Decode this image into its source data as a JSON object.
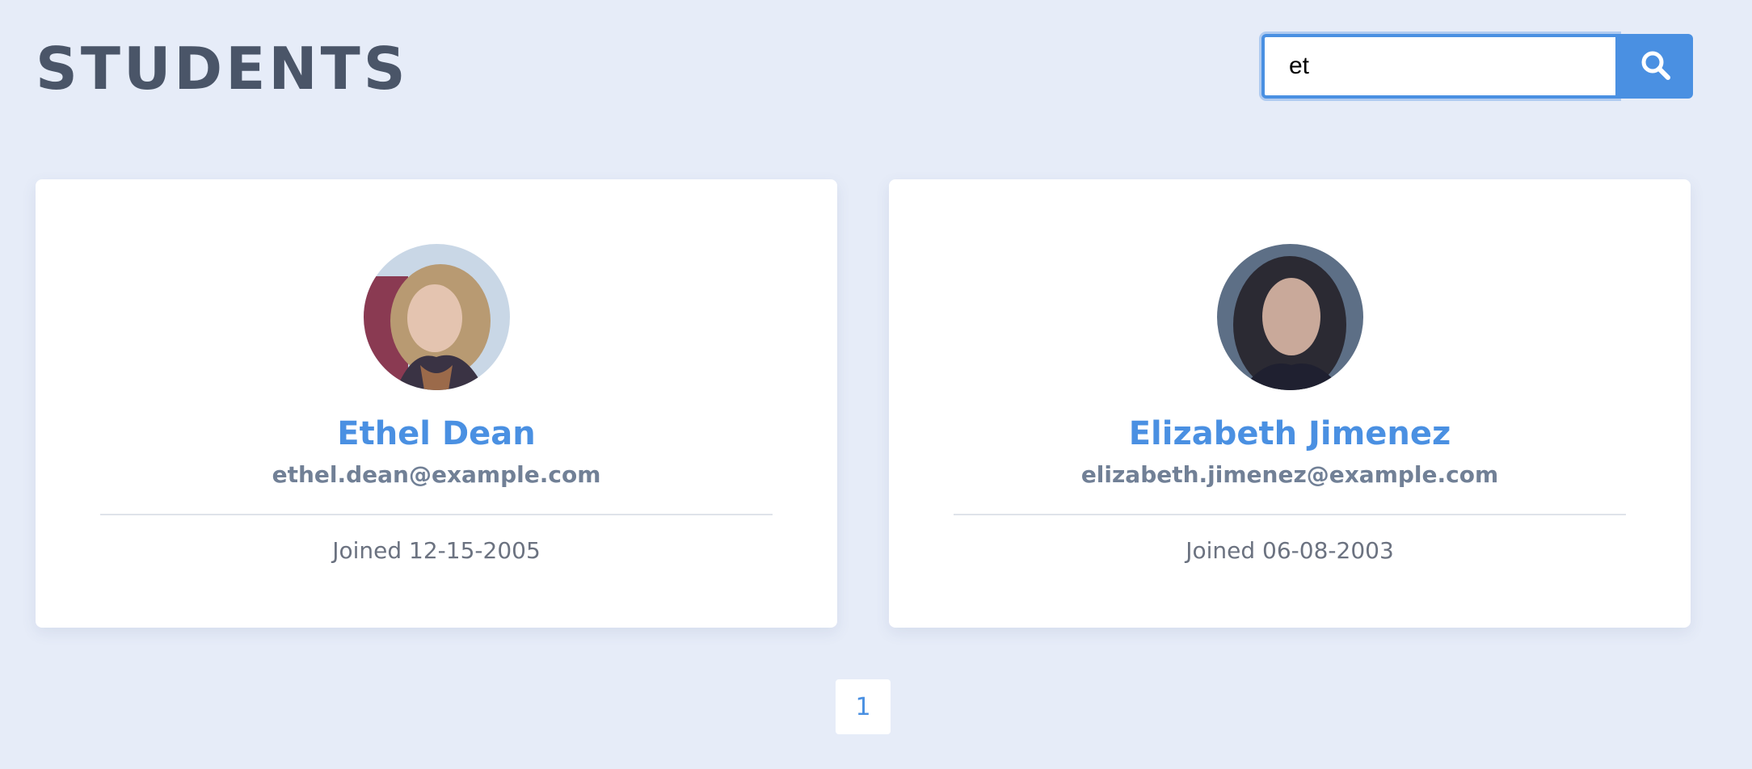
{
  "header": {
    "title": "STUDENTS"
  },
  "search": {
    "value": "et",
    "button_icon": "search-icon"
  },
  "students": [
    {
      "name": "Ethel Dean",
      "email": "ethel.dean@example.com",
      "joined": "Joined 12-15-2005",
      "avatar_icon": "avatar-photo"
    },
    {
      "name": "Elizabeth Jimenez",
      "email": "elizabeth.jimenez@example.com",
      "joined": "Joined 06-08-2003",
      "avatar_icon": "avatar-photo"
    }
  ],
  "pagination": {
    "pages": [
      "1"
    ]
  },
  "colors": {
    "background": "#e6ecf8",
    "accent": "#4a90e2",
    "title": "#4a5568",
    "email": "#718096"
  }
}
